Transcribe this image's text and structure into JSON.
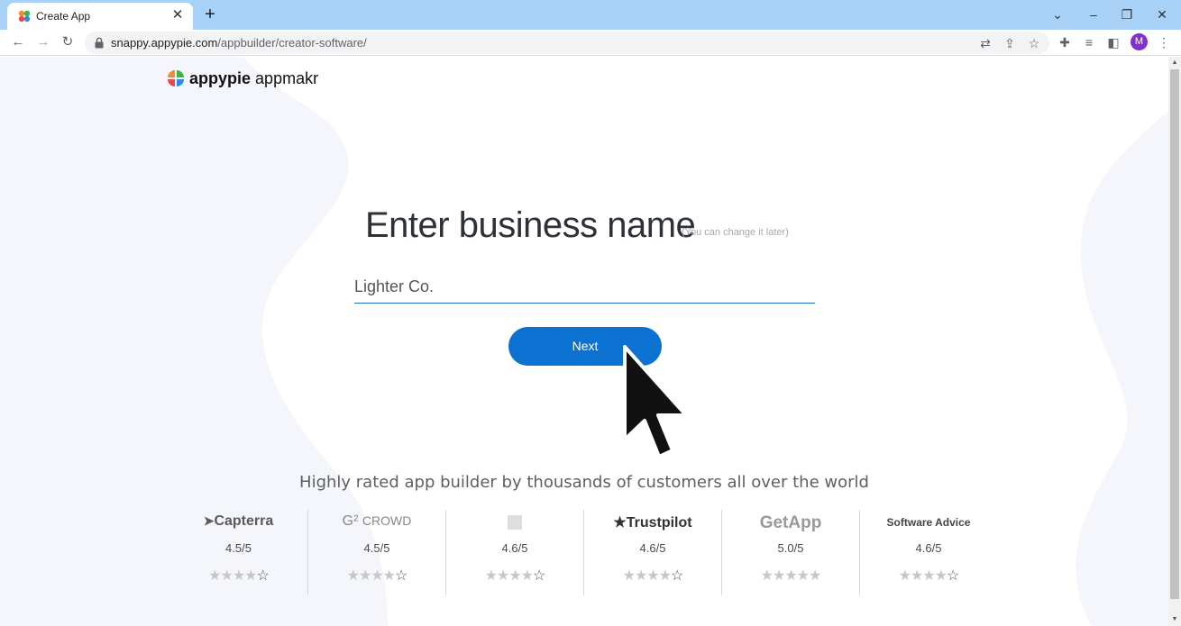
{
  "browser": {
    "tab_title": "Create App",
    "url_host": "snappy.appypie.com",
    "url_path": "/appbuilder/creator-software/",
    "avatar_initial": "M"
  },
  "page": {
    "logo_brand": "appypie",
    "logo_product": "appmakr",
    "heading": "Enter business name",
    "heading_note": "(You can change it later)",
    "business_name_value": "Lighter Co.",
    "next_label": "Next",
    "tagline": "Highly rated app builder by thousands of customers all over the world"
  },
  "ratings": [
    {
      "name": "Capterra",
      "score": "4.5/5",
      "stars": "★★★★☆"
    },
    {
      "name": "CROWD",
      "score": "4.5/5",
      "stars": "★★★★☆"
    },
    {
      "name": "",
      "score": "4.6/5",
      "stars": "★★★★☆"
    },
    {
      "name": "Trustpilot",
      "score": "4.6/5",
      "stars": "★★★★☆"
    },
    {
      "name": "GetApp",
      "score": "5.0/5",
      "stars": "★★★★★"
    },
    {
      "name": "Software Advice",
      "score": "4.6/5",
      "stars": "★★★★☆"
    }
  ],
  "colors": {
    "tabbar": "#a8d1f7",
    "accent": "#0b72d1",
    "avatar": "#8430ce"
  }
}
